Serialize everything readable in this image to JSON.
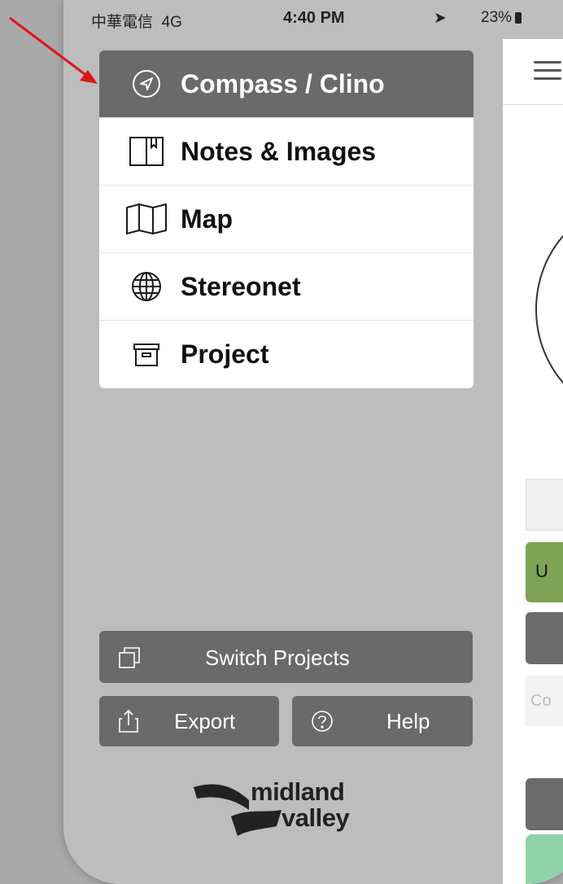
{
  "status_bar": {
    "carrier": "中華電信",
    "network": "4G",
    "time": "4:40 PM",
    "battery": "23%"
  },
  "menu": {
    "items": [
      {
        "label": "Compass / Clino",
        "icon": "compass-icon",
        "active": true
      },
      {
        "label": "Notes & Images",
        "icon": "notebook-icon",
        "active": false
      },
      {
        "label": "Map",
        "icon": "map-icon",
        "active": false
      },
      {
        "label": "Stereonet",
        "icon": "globe-icon",
        "active": false
      },
      {
        "label": "Project",
        "icon": "archive-box-icon",
        "active": false
      }
    ]
  },
  "actions": {
    "switch_projects": "Switch Projects",
    "export": "Export",
    "help": "Help"
  },
  "logo": {
    "line1": "midland",
    "line2": "valley"
  },
  "main_peek": {
    "green_button_text": "U",
    "input_placeholder": "Co"
  },
  "colors": {
    "active_menu": "#6a6a6a",
    "drawer_bg": "#bdbdbd",
    "annotation_arrow": "#e0151b",
    "green_button": "#7ea354"
  }
}
